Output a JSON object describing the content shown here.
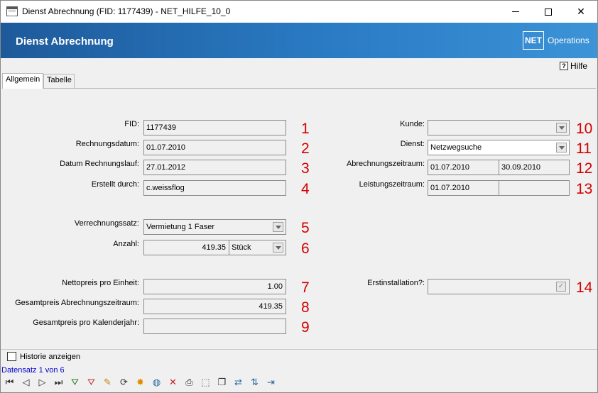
{
  "window": {
    "title": "Dienst Abrechnung (FID: 1177439)  - NET_HILFE_10_0"
  },
  "banner": {
    "heading": "Dienst Abrechnung",
    "logo_box": "NET",
    "logo_text": "Operations"
  },
  "help_label": "Hilfe",
  "tabs": [
    {
      "label": "Allgemein"
    },
    {
      "label": "Tabelle"
    }
  ],
  "left_fields": {
    "fid": {
      "label": "FID:",
      "value": "1177439",
      "marker": "1"
    },
    "rechnungsdatum": {
      "label": "Rechnungsdatum:",
      "value": "01.07.2010",
      "marker": "2"
    },
    "rechnungslauf": {
      "label": "Datum Rechnungslauf:",
      "value": "27.01.2012",
      "marker": "3"
    },
    "erstellt": {
      "label": "Erstellt durch:",
      "value": "c.weissflog",
      "marker": "4"
    },
    "verrechnungssatz": {
      "label": "Verrechnungssatz:",
      "value": "Vermietung 1 Faser",
      "marker": "5"
    },
    "anzahl": {
      "label": "Anzahl:",
      "value": "419.35",
      "unit": "Stück",
      "marker": "6"
    },
    "nettopreis": {
      "label": "Nettopreis pro Einheit:",
      "value": "1.00",
      "marker": "7"
    },
    "gesamtpreis_zeitraum": {
      "label": "Gesamtpreis Abrechnungszeitraum:",
      "value": "419.35",
      "marker": "8"
    },
    "gesamtpreis_jahr": {
      "label": "Gesamtpreis pro Kalenderjahr:",
      "value": "",
      "marker": "9"
    }
  },
  "right_fields": {
    "kunde": {
      "label": "Kunde:",
      "value": "",
      "marker": "10"
    },
    "dienst": {
      "label": "Dienst:",
      "value": "Netzwegsuche",
      "marker": "11"
    },
    "abrechnungszeitraum": {
      "label": "Abrechnungszeitraum:",
      "from": "01.07.2010",
      "to": "30.09.2010",
      "marker": "12"
    },
    "leistungszeitraum": {
      "label": "Leistungszeitraum:",
      "from": "01.07.2010",
      "to": "",
      "marker": "13"
    },
    "erstinstallation": {
      "label": "Erstinstallation?:",
      "marker": "14"
    }
  },
  "history_label": "Historie anzeigen",
  "record_status": "Datensatz 1 von 6",
  "toolbar_icons": [
    "first-record-icon",
    "prev-record-icon",
    "next-record-icon",
    "last-record-icon",
    "filter-add-icon",
    "filter-remove-icon",
    "edit-pencil-icon",
    "refresh-icon",
    "new-record-icon",
    "globe-icon",
    "delete-icon",
    "print-icon",
    "select-icon",
    "copy-icon",
    "transfer-icon",
    "sort-icon",
    "exit-icon"
  ],
  "colors": {
    "banner_start": "#1e5a9a",
    "banner_end": "#3c93d6",
    "marker_red": "#d40000",
    "record_blue": "#0000cc"
  }
}
